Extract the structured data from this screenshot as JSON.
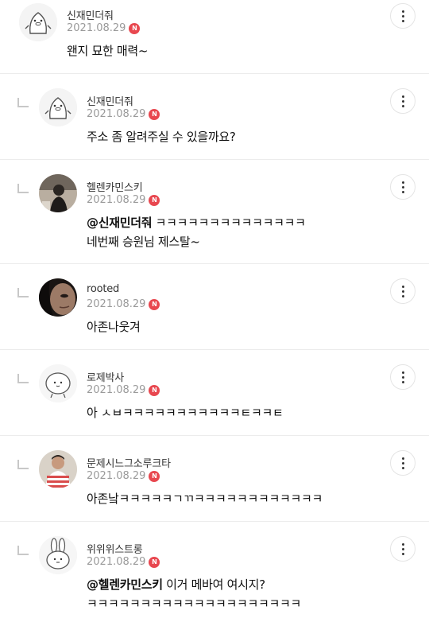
{
  "comments": [
    {
      "nickname": "신재민더줘",
      "date": "2021.08.29",
      "badge": "N",
      "mention": "",
      "text": "왠지 묘한 매력~",
      "text2": "",
      "avatar": "penguin-sticker",
      "reply": false
    },
    {
      "nickname": "신재민더줘",
      "date": "2021.08.29",
      "badge": "N",
      "mention": "",
      "text": "주소 좀 알려주실 수 있을까요?",
      "text2": "",
      "avatar": "penguin-sticker",
      "reply": true
    },
    {
      "nickname": "헬렌카민스키",
      "date": "2021.08.29",
      "badge": "N",
      "mention": "@신재민더줘",
      "text": " ㅋㅋㅋㅋㅋㅋㅋㅋㅋㅋㅋㅋㅋㅋ",
      "text2": "네번째 승원님 제스탈~",
      "avatar": "photo-person",
      "reply": true
    },
    {
      "nickname": "rooted",
      "date": "2021.08.29",
      "badge": "N",
      "mention": "",
      "text": "아존나웃겨",
      "text2": "",
      "avatar": "photo-face",
      "reply": true
    },
    {
      "nickname": "로제박사",
      "date": "2021.08.29",
      "badge": "N",
      "mention": "",
      "text": "아 ㅅㅂㅋㅋㅋㅋㅋㅋㅋㅋㅋㅋㅋㅌㅋㅋㅌ",
      "text2": "",
      "avatar": "blob-sticker",
      "reply": true
    },
    {
      "nickname": "문제시느그소루크타",
      "date": "2021.08.29",
      "badge": "N",
      "mention": "",
      "text": "아존낰ㅋㅋㅋㅋㅋㄱㄲㅋㅋㅋㅋㅋㅋㅋㅋㅋㅋㅋㅋ",
      "text2": "",
      "avatar": "photo-striped",
      "reply": true
    },
    {
      "nickname": "위위위스트롱",
      "date": "2021.08.29",
      "badge": "N",
      "mention": "@헬렌카민스키",
      "text": " 이거 메바여 여시지?",
      "text2": "ㅋㅋㅋㅋㅋㅋㅋㅋㅋㅋㅋㅋㅋㅋㅋㅋㅋㅋㅋㅋ",
      "avatar": "rabbit-sticker",
      "reply": true
    }
  ],
  "icons": {
    "more": "more-vertical-icon",
    "reply": "reply-arrow-icon",
    "new": "new-badge-icon"
  },
  "colors": {
    "badge": "#e8474f",
    "divider": "#ececec",
    "date": "#9a9a9a"
  }
}
